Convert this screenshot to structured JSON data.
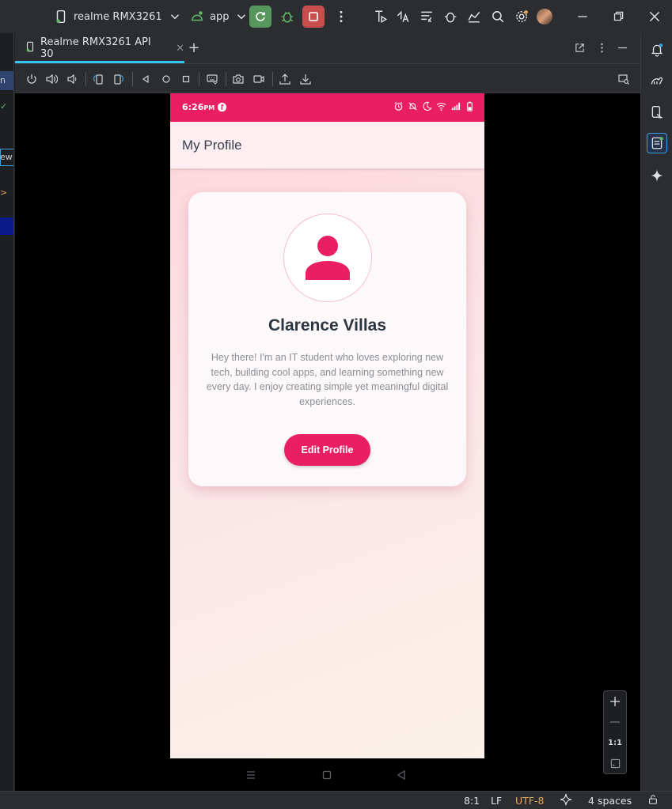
{
  "titlebar": {
    "device": "realme RMX3261",
    "module": "app"
  },
  "emulator": {
    "tab_label": "Realme RMX3261 API 30",
    "zoom_ratio": "1:1"
  },
  "phone": {
    "status_time": "6:26",
    "status_ampm": "PM",
    "app_title": "My Profile",
    "profile": {
      "name": "Clarence Villas",
      "bio": "Hey there! I'm an IT student who loves exploring new tech, building cool apps, and learning something new every day. I enjoy creating simple yet meaningful digital experiences.",
      "edit_button": "Edit Profile"
    },
    "colors": {
      "accent": "#e91e63",
      "appbar": "#fdeef2"
    }
  },
  "left_strip_fragments": [
    "n",
    "ew",
    ">"
  ],
  "statusbar": {
    "position": "8:1",
    "line_ending": "LF",
    "encoding": "UTF-8",
    "indent": "4 spaces"
  }
}
